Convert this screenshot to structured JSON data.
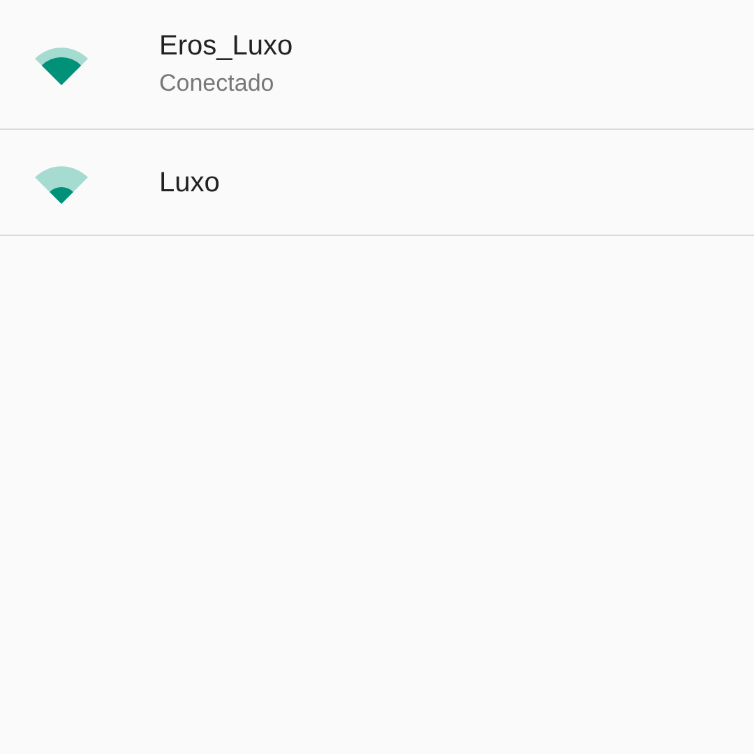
{
  "networks": [
    {
      "name": "Eros_Luxo",
      "status": "Conectado",
      "kind": "strong"
    },
    {
      "name": "Luxo",
      "kind": "weak"
    }
  ]
}
